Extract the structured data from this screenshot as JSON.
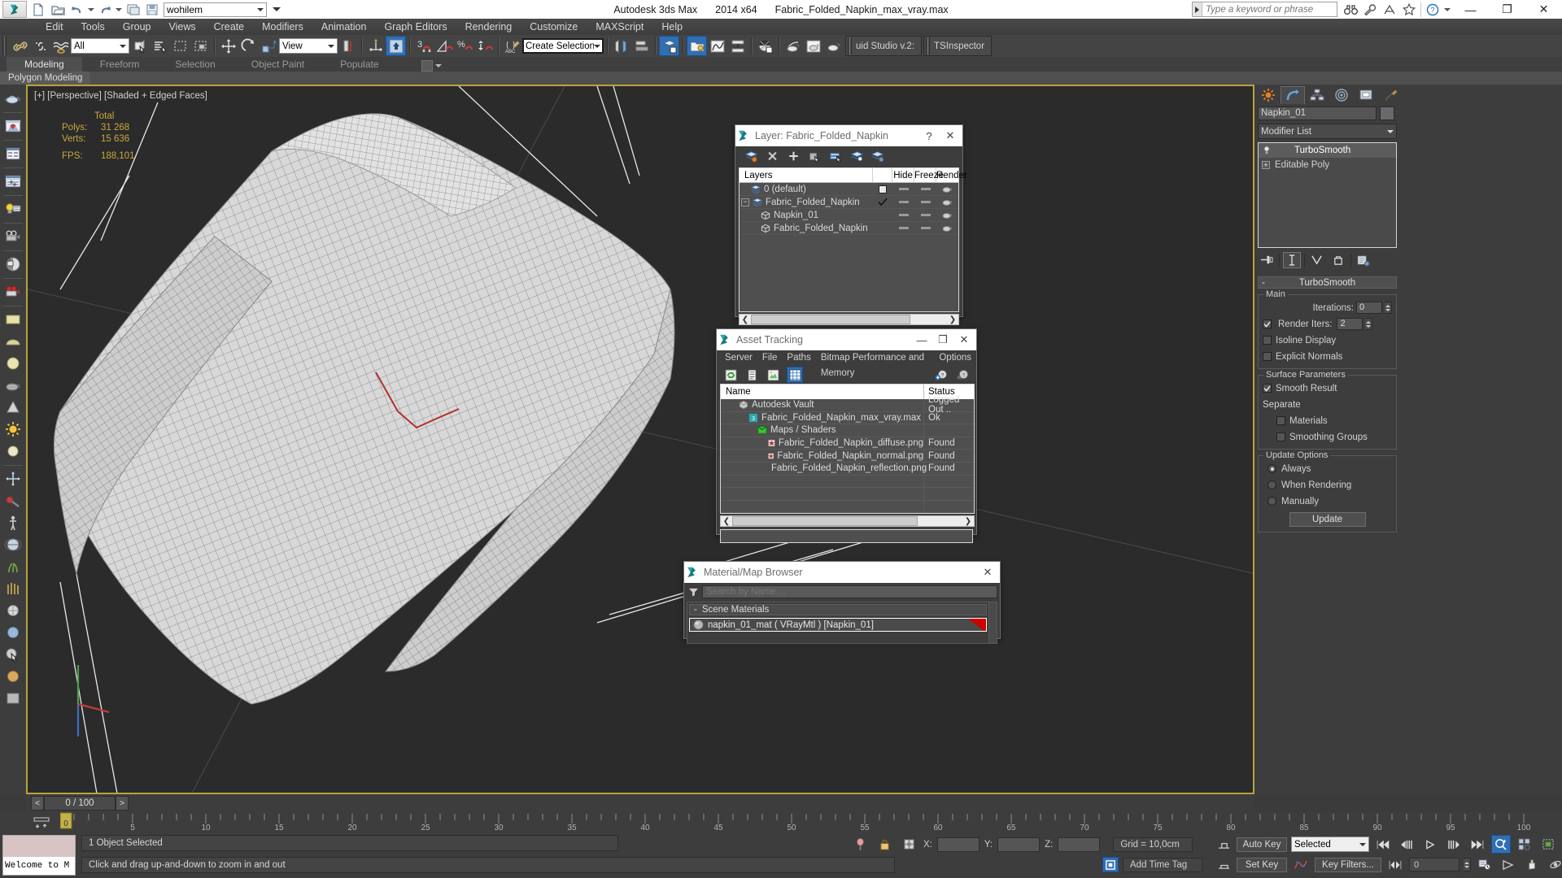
{
  "titlebar": {
    "app_name": "Autodesk 3ds Max",
    "version": "2014 x64",
    "filename": "Fabric_Folded_Napkin_max_vray.max",
    "workspace": "wohilem",
    "search_placeholder": "Type a keyword or phrase",
    "minimize": "—",
    "maximize": "❐",
    "close": "✕"
  },
  "menu": {
    "items": [
      "Edit",
      "Tools",
      "Group",
      "Views",
      "Create",
      "Modifiers",
      "Animation",
      "Graph Editors",
      "Rendering",
      "Customize",
      "MAXScript",
      "Help"
    ]
  },
  "toolbar": {
    "selection_filter": "All",
    "reference_coord": "View",
    "named_selection_set": "Create Selection Se",
    "plugins": [
      "uid Studio v.2:",
      "TSInspector"
    ]
  },
  "ribbon": {
    "tabs": [
      "Modeling",
      "Freeform",
      "Selection",
      "Object Paint",
      "Populate"
    ],
    "active_tab": "Modeling",
    "subtitle": "Polygon Modeling"
  },
  "viewport": {
    "label": "[+] [Perspective] [Shaded + Edged Faces]",
    "stats_header": "Total",
    "polys_label": "Polys:",
    "polys_value": "31 268",
    "verts_label": "Verts:",
    "verts_value": "15 636",
    "fps_label": "FPS:",
    "fps_value": "188,101"
  },
  "layer_dialog": {
    "title": "Layer: Fabric_Folded_Napkin",
    "help": "?",
    "close": "✕",
    "columns": [
      "Layers",
      "",
      "Hide",
      "Freeze",
      "Render"
    ],
    "rows": [
      {
        "name": "0 (default)",
        "icon": "layer-icon",
        "indent": 1,
        "current": false,
        "checkbox": true
      },
      {
        "name": "Fabric_Folded_Napkin",
        "icon": "layer-icon",
        "indent": 0,
        "current": true,
        "expander": "−"
      },
      {
        "name": "Napkin_01",
        "icon": "object-icon",
        "indent": 2,
        "current": false
      },
      {
        "name": "Fabric_Folded_Napkin",
        "icon": "object-icon",
        "indent": 2,
        "current": false
      }
    ]
  },
  "asset_dialog": {
    "title": "Asset Tracking",
    "minimize": "—",
    "maximize": "❐",
    "close": "✕",
    "menu": [
      "Server",
      "File",
      "Paths",
      "Bitmap Performance and Memory",
      "Options"
    ],
    "columns": {
      "name": "Name",
      "status": "Status"
    },
    "rows": [
      {
        "name": "Autodesk Vault",
        "status": "Logged Out ..",
        "indent": 1,
        "icon": "vault-icon"
      },
      {
        "name": "Fabric_Folded_Napkin_max_vray.max",
        "status": "Ok",
        "indent": 2,
        "icon": "max-file-icon"
      },
      {
        "name": "Maps / Shaders",
        "status": "",
        "indent": 3,
        "icon": "maps-icon"
      },
      {
        "name": "Fabric_Folded_Napkin_diffuse.png",
        "status": "Found",
        "indent": 4,
        "icon": "bitmap-icon"
      },
      {
        "name": "Fabric_Folded_Napkin_normal.png",
        "status": "Found",
        "indent": 4,
        "icon": "bitmap-icon"
      },
      {
        "name": "Fabric_Folded_Napkin_reflection.png",
        "status": "Found",
        "indent": 4,
        "icon": "bitmap-icon"
      },
      {
        "name": "",
        "status": "",
        "indent": 0,
        "icon": ""
      },
      {
        "name": "",
        "status": "",
        "indent": 0,
        "icon": ""
      },
      {
        "name": "",
        "status": "",
        "indent": 0,
        "icon": ""
      }
    ]
  },
  "material_browser": {
    "title": "Material/Map Browser",
    "close": "✕",
    "search_placeholder": "Search by Name ...",
    "group_label": "Scene Materials",
    "group_collapse": "-",
    "items": [
      {
        "label": "napkin_01_mat  ( VRayMtl )  [Napkin_01]"
      }
    ]
  },
  "command_panel": {
    "object_name": "Napkin_01",
    "modifier_list_label": "Modifier List",
    "stack": [
      {
        "label": "TurboSmooth",
        "selected": true
      },
      {
        "label": "Editable Poly",
        "selected": false,
        "expander": "+"
      }
    ],
    "rollout": {
      "title": "TurboSmooth",
      "collapse": "-",
      "groups": [
        {
          "title": "Main",
          "fields": [
            {
              "type": "spinner",
              "label": "Iterations:",
              "value": "0"
            },
            {
              "type": "checkbox_spinner",
              "label": "Render Iters:",
              "value": "2",
              "checked": true
            },
            {
              "type": "checkbox",
              "label": "Isoline Display",
              "checked": false
            },
            {
              "type": "checkbox",
              "label": "Explicit Normals",
              "checked": false
            }
          ]
        },
        {
          "title": "Surface Parameters",
          "fields": [
            {
              "type": "checkbox",
              "label": "Smooth Result",
              "checked": true
            },
            {
              "type": "text",
              "label": "Separate"
            },
            {
              "type": "checkbox_indent",
              "label": "Materials",
              "checked": false
            },
            {
              "type": "checkbox_indent",
              "label": "Smoothing Groups",
              "checked": false
            }
          ]
        },
        {
          "title": "Update Options",
          "fields": [
            {
              "type": "radio",
              "label": "Always",
              "checked": true
            },
            {
              "type": "radio",
              "label": "When Rendering",
              "checked": false
            },
            {
              "type": "radio",
              "label": "Manually",
              "checked": false
            },
            {
              "type": "button",
              "label": "Update"
            }
          ]
        }
      ]
    }
  },
  "timeline": {
    "current_frame": "0 / 100",
    "prev": "<",
    "next": ">",
    "ticks": [
      "5",
      "10",
      "15",
      "20",
      "25",
      "30",
      "35",
      "40",
      "45",
      "50",
      "55",
      "60",
      "65",
      "70",
      "75",
      "80",
      "85",
      "90",
      "95",
      "100"
    ],
    "start_tick": "0"
  },
  "statusbar": {
    "maxscript_mini": "Welcome to M",
    "selection_status": "1 Object Selected",
    "prompt": "Click and drag up-and-down to zoom in and out",
    "coord_x_label": "X:",
    "coord_y_label": "Y:",
    "coord_z_label": "Z:",
    "coord_x": "",
    "coord_y": "",
    "coord_z": "",
    "grid": "Grid = 10,0cm",
    "add_time_tag": "Add Time Tag",
    "auto_key": "Auto Key",
    "set_key": "Set Key",
    "key_mode": "Selected",
    "key_filters": "Key Filters...",
    "key_frame_value": "0"
  }
}
